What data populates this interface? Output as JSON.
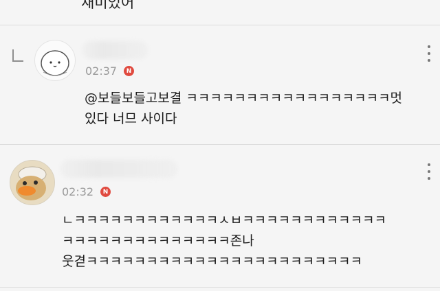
{
  "prev_comment": {
    "tail_text": "재미있어"
  },
  "comments": [
    {
      "time": "02:37",
      "badge": "N",
      "is_reply": true,
      "lines": [
        "@보들보들고보결 ㅋㅋㅋㅋㅋㅋㅋㅋㅋㅋㅋㅋㅋㅋㅋㅋㅋ멋",
        "있다 너므 사이다"
      ]
    },
    {
      "time": "02:32",
      "badge": "N",
      "is_reply": false,
      "lines": [
        "ㄴㅋㅋㅋㅋㅋㅋㅋㅋㅋㅋㅋㅋㅅㅂㅋㅋㅋㅋㅋㅋㅋㅋㅋㅋㅋㅋ",
        "ㅋㅋㅋㅋㅋㅋㅋㅋㅋㅋㅋㅋㅋㅋ존나",
        "웃겯ㅋㅋㅋㅋㅋㅋㅋㅋㅋㅋㅋㅋㅋㅋㅋㅋㅋㅋㅋㅋㅋㅋㅋ"
      ]
    }
  ],
  "colors": {
    "badge": "#e04a3f",
    "time": "#9a9a9a",
    "background": "#f5f5f5"
  },
  "icons": [
    "reply-arrow-icon",
    "more-options-icon",
    "new-badge-icon"
  ]
}
